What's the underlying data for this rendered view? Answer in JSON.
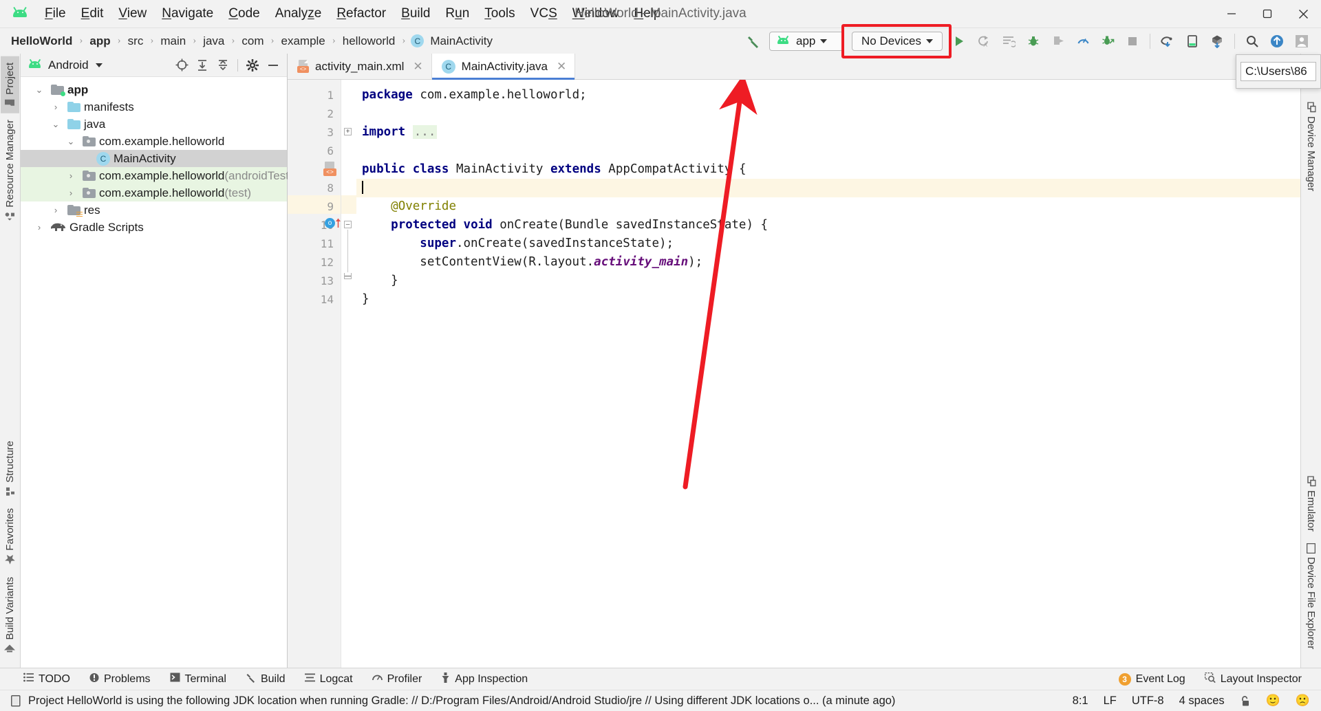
{
  "window": {
    "title": "HelloWorld - MainActivity.java",
    "minimize": "–",
    "maximize": "▢",
    "close": "✕"
  },
  "menubar": {
    "logo": "android-logo",
    "items": [
      {
        "label": "File",
        "mnemonic": "F"
      },
      {
        "label": "Edit",
        "mnemonic": "E"
      },
      {
        "label": "View",
        "mnemonic": "V"
      },
      {
        "label": "Navigate",
        "mnemonic": "N"
      },
      {
        "label": "Code",
        "mnemonic": "C"
      },
      {
        "label": "Analyze",
        "mnemonic": "z"
      },
      {
        "label": "Refactor",
        "mnemonic": "R"
      },
      {
        "label": "Build",
        "mnemonic": "B"
      },
      {
        "label": "Run",
        "mnemonic": "u"
      },
      {
        "label": "Tools",
        "mnemonic": "T"
      },
      {
        "label": "VCS",
        "mnemonic": "S"
      },
      {
        "label": "Window",
        "mnemonic": "W"
      },
      {
        "label": "Help",
        "mnemonic": "H"
      }
    ]
  },
  "breadcrumb": {
    "separator": "›",
    "items": [
      "HelloWorld",
      "app",
      "src",
      "main",
      "java",
      "com",
      "example",
      "helloworld"
    ],
    "class_badge": "C",
    "class_name": "MainActivity"
  },
  "toolbar": {
    "hammer": "hammer-build-icon",
    "module_combo": "app",
    "devices_combo": "No Devices",
    "highlight_color": "#ee1c24",
    "icons": [
      "run-icon",
      "rerun-icon",
      "apply-changes-icon",
      "debug-icon",
      "attach-debugger-icon",
      "profiler-icon",
      "debug-attach-icon",
      "stop-icon",
      "sdk-manager-icon",
      "avd-manager-icon",
      "sync-gradle-icon",
      "search-everywhere-icon",
      "update-project-icon",
      "account-icon"
    ]
  },
  "tooltip": {
    "path_value": "C:\\Users\\86"
  },
  "left_strip": {
    "tabs": [
      {
        "label": "Project",
        "icon": "project-folder-icon",
        "selected": true
      },
      {
        "label": "Resource Manager",
        "icon": "resource-manager-icon",
        "selected": false
      }
    ],
    "bottom_tabs": [
      {
        "label": "Structure",
        "icon": "structure-icon"
      },
      {
        "label": "Favorites",
        "icon": "star-icon"
      },
      {
        "label": "Build Variants",
        "icon": "build-variants-icon"
      }
    ]
  },
  "right_strip": {
    "tabs": [
      {
        "label": "Device Manager",
        "icon": "device-manager-icon"
      }
    ],
    "bottom_tabs": [
      {
        "label": "Emulator",
        "icon": "emulator-icon"
      },
      {
        "label": "Device File Explorer",
        "icon": "device-file-explorer-icon"
      }
    ]
  },
  "project_panel": {
    "header_title": "Android",
    "header_icon": "android-logo-icon",
    "header_caret": "chevron-down-icon",
    "tools": [
      "locate-icon",
      "expand-all-icon",
      "collapse-all-icon",
      "settings-gear-icon",
      "hide-icon"
    ],
    "tree": [
      {
        "label": "app",
        "indent": 0,
        "arrow": "v",
        "icon": "module-folder",
        "bold": true,
        "state": "normal",
        "suffix": ""
      },
      {
        "label": "manifests",
        "indent": 1,
        "arrow": ">",
        "icon": "folder-blue",
        "bold": false,
        "state": "normal",
        "suffix": ""
      },
      {
        "label": "java",
        "indent": 1,
        "arrow": "v",
        "icon": "folder-blue",
        "bold": false,
        "state": "normal",
        "suffix": ""
      },
      {
        "label": "com.example.helloworld",
        "indent": 2,
        "arrow": "v",
        "icon": "package-folder",
        "bold": false,
        "state": "normal",
        "suffix": ""
      },
      {
        "label": "MainActivity",
        "indent": 3,
        "arrow": "",
        "icon": "class-badge",
        "bold": false,
        "state": "selected",
        "suffix": ""
      },
      {
        "label": "com.example.helloworld",
        "indent": 2,
        "arrow": ">",
        "icon": "package-folder",
        "bold": false,
        "state": "green",
        "suffix": " (androidTest)"
      },
      {
        "label": "com.example.helloworld",
        "indent": 2,
        "arrow": ">",
        "icon": "package-folder",
        "bold": false,
        "state": "green",
        "suffix": " (test)"
      },
      {
        "label": "res",
        "indent": 1,
        "arrow": ">",
        "icon": "res-folder",
        "bold": false,
        "state": "normal",
        "suffix": ""
      },
      {
        "label": "Gradle Scripts",
        "indent": 0,
        "arrow": ">",
        "icon": "gradle-icon",
        "bold": false,
        "state": "normal",
        "suffix": ""
      }
    ]
  },
  "editor": {
    "tabs": [
      {
        "label": "activity_main.xml",
        "icon": "xml-layout-icon",
        "active": false,
        "close": "✕"
      },
      {
        "label": "MainActivity.java",
        "icon": "java-class-icon",
        "active": true,
        "close": "✕"
      }
    ],
    "line_numbers": [
      "1",
      "2",
      "3",
      "6",
      "7",
      "8",
      "9",
      "10",
      "11",
      "12",
      "13",
      "14"
    ],
    "lines": [
      {
        "n": "1",
        "html": "<span class=\"kw\">package</span> <span class=\"txt\">com.example.helloworld;</span>",
        "highlight": false
      },
      {
        "n": "2",
        "html": "",
        "highlight": false
      },
      {
        "n": "3",
        "html": "<span class=\"kw\">import</span> <span class=\"impdots\">...</span>",
        "highlight": false
      },
      {
        "n": "6",
        "html": "",
        "highlight": false
      },
      {
        "n": "7",
        "html": "<span class=\"kw\">public class</span> <span class=\"txt\">MainActivity</span> <span class=\"kw\">extends</span> <span class=\"txt\">AppCompatActivity {</span>",
        "highlight": false
      },
      {
        "n": "8",
        "html": "<span class=\"caret-bar\"></span>",
        "highlight": true
      },
      {
        "n": "9",
        "html": "    <span class=\"ann\">@Override</span>",
        "highlight": false
      },
      {
        "n": "10",
        "html": "    <span class=\"kw\">protected void</span> <span class=\"txt\">onCreate(Bundle savedInstanceState) {</span>",
        "highlight": false
      },
      {
        "n": "11",
        "html": "        <span class=\"kw\">super</span><span class=\"txt\">.onCreate(savedInstanceState);</span>",
        "highlight": false
      },
      {
        "n": "12",
        "html": "        <span class=\"txt\">setContentView(R.layout.</span><span class=\"fld\">activity_main</span><span class=\"txt\">);</span>",
        "highlight": false
      },
      {
        "n": "13",
        "html": "    <span class=\"txt\">}</span>",
        "highlight": false
      },
      {
        "n": "14",
        "html": "<span class=\"txt\">}</span>",
        "highlight": false
      }
    ],
    "gutter_icons": [
      {
        "line": "7",
        "icon": "related-layout-file-icon"
      },
      {
        "line": "10",
        "icon": "overriding-method-icon"
      }
    ]
  },
  "annotation": {
    "arrow_color": "#ee1c24",
    "description": "red-arrow-pointing-to-no-devices"
  },
  "bottom_bar": {
    "items": [
      {
        "label": "TODO",
        "icon": "todo-icon"
      },
      {
        "label": "Problems",
        "icon": "problems-icon"
      },
      {
        "label": "Terminal",
        "icon": "terminal-icon"
      },
      {
        "label": "Build",
        "icon": "build-hammer-icon"
      },
      {
        "label": "Logcat",
        "icon": "logcat-icon"
      },
      {
        "label": "Profiler",
        "icon": "profiler-icon"
      },
      {
        "label": "App Inspection",
        "icon": "app-inspection-icon"
      }
    ],
    "right_items": [
      {
        "label": "Event Log",
        "icon": "event-log-icon",
        "badge": "3"
      },
      {
        "label": "Layout Inspector",
        "icon": "layout-inspector-icon",
        "badge": ""
      }
    ]
  },
  "status_bar": {
    "icon": "status-message-icon",
    "message": "Project HelloWorld is using the following JDK location when running Gradle: // D:/Program Files/Android/Android Studio/jre // Using different JDK locations o... (a minute ago)",
    "caret_position": "8:1",
    "line_separator": "LF",
    "encoding": "UTF-8",
    "indent": "4 spaces",
    "lock": "unlocked-padlock-icon",
    "emoji_happy": "🙂",
    "emoji_sad": "🙁"
  }
}
